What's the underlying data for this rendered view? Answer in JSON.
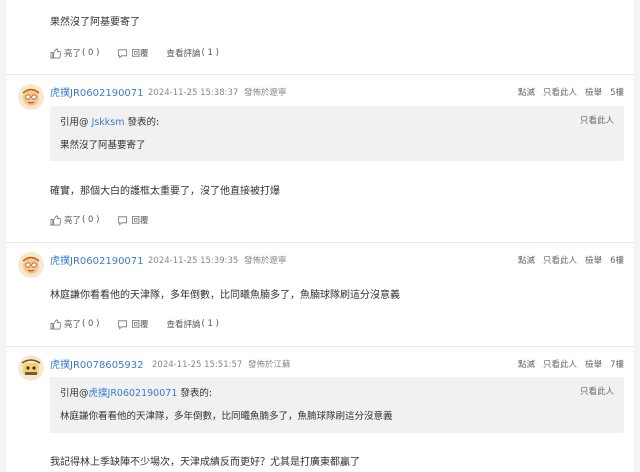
{
  "icons": {
    "like": "thumbs-up-icon",
    "reply": "comment-icon",
    "avatar": "cartoon-face-avatar"
  },
  "colors": {
    "link": "#3a7bd5",
    "quote_bg": "#f1f1f1"
  },
  "post0": {
    "body": "果然沒了阿基要寄了",
    "like": "亮了",
    "like_count": "( 0 )",
    "reply": "回覆",
    "view_replies": "查看評論",
    "view_count": "( 1 )"
  },
  "post5": {
    "username": "虎撲JR0602190071",
    "timestamp": "2024-11-25 15:38:37",
    "location": "發佈於遼寧",
    "action_like": "點滅",
    "action_only": "只看此人",
    "action_report": "檢舉",
    "floor": "5樓",
    "quote_prefix": "引用@",
    "quote_user": "Jskksm",
    "quote_suffix": "發表的:",
    "quote_only": "只看此人",
    "quote_body": "果然沒了阿基要寄了",
    "body": "確實，那個大白的護框太重要了，沒了他直接被打爆",
    "like": "亮了",
    "like_count": "( 0 )",
    "reply": "回覆"
  },
  "post6": {
    "username": "虎撲JR0602190071",
    "timestamp": "2024-11-25 15:39:35",
    "location": "發佈於遼寧",
    "action_like": "點滅",
    "action_only": "只看此人",
    "action_report": "檢舉",
    "floor": "6樓",
    "body": "林庭謙你看看他的天津隊，多年倒數，比同曦魚腩多了，魚腩球隊刷這分沒意義",
    "like": "亮了",
    "like_count": "( 0 )",
    "reply": "回覆",
    "view_replies": "查看評論",
    "view_count": "( 1 )"
  },
  "post7": {
    "username": "虎撲JR0078605932",
    "timestamp": "2024-11-25 15:51:57",
    "location": "發佈於江蘇",
    "action_like": "點滅",
    "action_only": "只看此人",
    "action_report": "檢舉",
    "floor": "7樓",
    "quote_prefix": "引用@",
    "quote_user": "虎撲JR0602190071",
    "quote_suffix": "發表的:",
    "quote_only": "只看此人",
    "quote_body": "林庭謙你看看他的天津隊，多年倒數，比同曦魚腩多了，魚腩球隊刷這分沒意義",
    "body": "我記得林上季缺陣不少場次，天津成績反而更好？尤其是打廣東都贏了"
  }
}
